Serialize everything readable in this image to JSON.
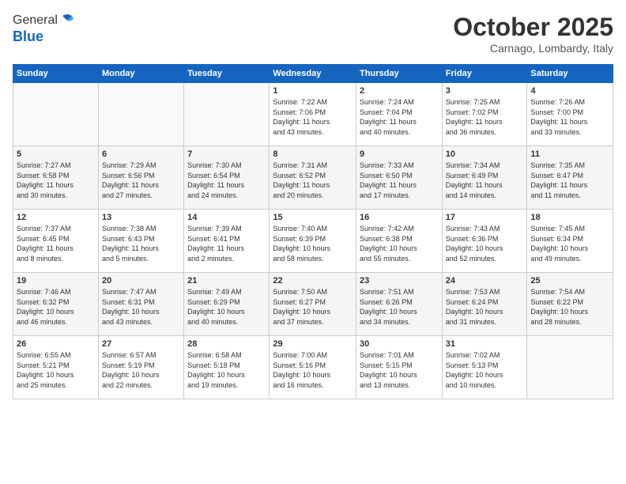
{
  "logo": {
    "general": "General",
    "blue": "Blue"
  },
  "header": {
    "month": "October 2025",
    "location": "Carnago, Lombardy, Italy"
  },
  "weekdays": [
    "Sunday",
    "Monday",
    "Tuesday",
    "Wednesday",
    "Thursday",
    "Friday",
    "Saturday"
  ],
  "weeks": [
    [
      {
        "day": "",
        "info": ""
      },
      {
        "day": "",
        "info": ""
      },
      {
        "day": "",
        "info": ""
      },
      {
        "day": "1",
        "info": "Sunrise: 7:22 AM\nSunset: 7:06 PM\nDaylight: 11 hours\nand 43 minutes."
      },
      {
        "day": "2",
        "info": "Sunrise: 7:24 AM\nSunset: 7:04 PM\nDaylight: 11 hours\nand 40 minutes."
      },
      {
        "day": "3",
        "info": "Sunrise: 7:25 AM\nSunset: 7:02 PM\nDaylight: 11 hours\nand 36 minutes."
      },
      {
        "day": "4",
        "info": "Sunrise: 7:26 AM\nSunset: 7:00 PM\nDaylight: 11 hours\nand 33 minutes."
      }
    ],
    [
      {
        "day": "5",
        "info": "Sunrise: 7:27 AM\nSunset: 6:58 PM\nDaylight: 11 hours\nand 30 minutes."
      },
      {
        "day": "6",
        "info": "Sunrise: 7:29 AM\nSunset: 6:56 PM\nDaylight: 11 hours\nand 27 minutes."
      },
      {
        "day": "7",
        "info": "Sunrise: 7:30 AM\nSunset: 6:54 PM\nDaylight: 11 hours\nand 24 minutes."
      },
      {
        "day": "8",
        "info": "Sunrise: 7:31 AM\nSunset: 6:52 PM\nDaylight: 11 hours\nand 20 minutes."
      },
      {
        "day": "9",
        "info": "Sunrise: 7:33 AM\nSunset: 6:50 PM\nDaylight: 11 hours\nand 17 minutes."
      },
      {
        "day": "10",
        "info": "Sunrise: 7:34 AM\nSunset: 6:49 PM\nDaylight: 11 hours\nand 14 minutes."
      },
      {
        "day": "11",
        "info": "Sunrise: 7:35 AM\nSunset: 6:47 PM\nDaylight: 11 hours\nand 11 minutes."
      }
    ],
    [
      {
        "day": "12",
        "info": "Sunrise: 7:37 AM\nSunset: 6:45 PM\nDaylight: 11 hours\nand 8 minutes."
      },
      {
        "day": "13",
        "info": "Sunrise: 7:38 AM\nSunset: 6:43 PM\nDaylight: 11 hours\nand 5 minutes."
      },
      {
        "day": "14",
        "info": "Sunrise: 7:39 AM\nSunset: 6:41 PM\nDaylight: 11 hours\nand 2 minutes."
      },
      {
        "day": "15",
        "info": "Sunrise: 7:40 AM\nSunset: 6:39 PM\nDaylight: 10 hours\nand 58 minutes."
      },
      {
        "day": "16",
        "info": "Sunrise: 7:42 AM\nSunset: 6:38 PM\nDaylight: 10 hours\nand 55 minutes."
      },
      {
        "day": "17",
        "info": "Sunrise: 7:43 AM\nSunset: 6:36 PM\nDaylight: 10 hours\nand 52 minutes."
      },
      {
        "day": "18",
        "info": "Sunrise: 7:45 AM\nSunset: 6:34 PM\nDaylight: 10 hours\nand 49 minutes."
      }
    ],
    [
      {
        "day": "19",
        "info": "Sunrise: 7:46 AM\nSunset: 6:32 PM\nDaylight: 10 hours\nand 46 minutes."
      },
      {
        "day": "20",
        "info": "Sunrise: 7:47 AM\nSunset: 6:31 PM\nDaylight: 10 hours\nand 43 minutes."
      },
      {
        "day": "21",
        "info": "Sunrise: 7:49 AM\nSunset: 6:29 PM\nDaylight: 10 hours\nand 40 minutes."
      },
      {
        "day": "22",
        "info": "Sunrise: 7:50 AM\nSunset: 6:27 PM\nDaylight: 10 hours\nand 37 minutes."
      },
      {
        "day": "23",
        "info": "Sunrise: 7:51 AM\nSunset: 6:26 PM\nDaylight: 10 hours\nand 34 minutes."
      },
      {
        "day": "24",
        "info": "Sunrise: 7:53 AM\nSunset: 6:24 PM\nDaylight: 10 hours\nand 31 minutes."
      },
      {
        "day": "25",
        "info": "Sunrise: 7:54 AM\nSunset: 6:22 PM\nDaylight: 10 hours\nand 28 minutes."
      }
    ],
    [
      {
        "day": "26",
        "info": "Sunrise: 6:55 AM\nSunset: 5:21 PM\nDaylight: 10 hours\nand 25 minutes."
      },
      {
        "day": "27",
        "info": "Sunrise: 6:57 AM\nSunset: 5:19 PM\nDaylight: 10 hours\nand 22 minutes."
      },
      {
        "day": "28",
        "info": "Sunrise: 6:58 AM\nSunset: 5:18 PM\nDaylight: 10 hours\nand 19 minutes."
      },
      {
        "day": "29",
        "info": "Sunrise: 7:00 AM\nSunset: 5:16 PM\nDaylight: 10 hours\nand 16 minutes."
      },
      {
        "day": "30",
        "info": "Sunrise: 7:01 AM\nSunset: 5:15 PM\nDaylight: 10 hours\nand 13 minutes."
      },
      {
        "day": "31",
        "info": "Sunrise: 7:02 AM\nSunset: 5:13 PM\nDaylight: 10 hours\nand 10 minutes."
      },
      {
        "day": "",
        "info": ""
      }
    ]
  ]
}
